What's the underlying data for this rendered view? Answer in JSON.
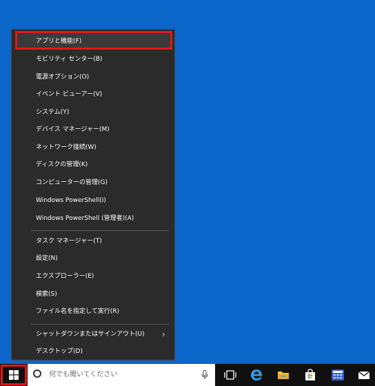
{
  "menu": {
    "items": [
      {
        "label": "アプリと機能(F)"
      },
      {
        "label": "モビリティ センター(B)"
      },
      {
        "label": "電源オプション(O)"
      },
      {
        "label": "イベント ビューアー(V)"
      },
      {
        "label": "システム(Y)"
      },
      {
        "label": "デバイス マネージャー(M)"
      },
      {
        "label": "ネットワーク接続(W)"
      },
      {
        "label": "ディスクの管理(K)"
      },
      {
        "label": "コンピューターの管理(G)"
      },
      {
        "label": "Windows PowerShell(I)"
      },
      {
        "label": "Windows PowerShell (管理者)(A)"
      },
      {
        "label": "タスク マネージャー(T)"
      },
      {
        "label": "設定(N)"
      },
      {
        "label": "エクスプローラー(E)"
      },
      {
        "label": "検索(S)"
      },
      {
        "label": "ファイル名を指定して実行(R)"
      },
      {
        "label": "シャットダウンまたはサインアウト(U)"
      },
      {
        "label": "デスクトップ(D)"
      }
    ]
  },
  "taskbar": {
    "search_placeholder": "何でも聞いてください",
    "icons": [
      "windows-start-icon",
      "search-icon",
      "microphone-icon",
      "task-view-icon",
      "edge-icon",
      "file-explorer-icon",
      "store-icon",
      "calculator-icon",
      "mail-icon"
    ]
  },
  "colors": {
    "desktop": "#0a66c8",
    "menu_bg": "#2b2b2b",
    "highlight": "#e8141b",
    "taskbar": "#101010"
  }
}
